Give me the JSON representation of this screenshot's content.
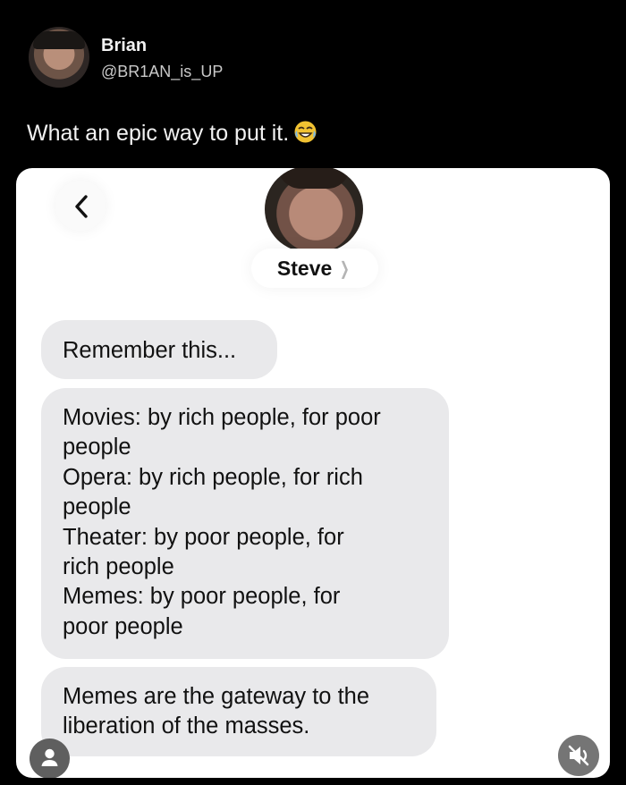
{
  "tweet": {
    "author_name": "Brian",
    "author_handle": "@BR1AN_is_UP",
    "text": "What an epic way to put it.",
    "emoji": "tears-of-joy-emoji"
  },
  "message_screen": {
    "contact_name": "Steve",
    "messages": [
      {
        "lines": [
          "Remember this..."
        ]
      },
      {
        "lines": [
          "Movies: by rich people, for poor",
          "people",
          "Opera: by rich people, for rich",
          "people",
          "Theater: by poor people, for",
          "rich people",
          "Memes: by poor people, for",
          "poor people"
        ]
      },
      {
        "lines": [
          "Memes are the gateway to the",
          "liberation of the masses."
        ]
      }
    ]
  },
  "icons": {
    "back": "chevron-left-icon",
    "contact_chevron": "chevron-right-icon",
    "person": "person-icon",
    "muted_audio": "speaker-muted-icon"
  },
  "colors": {
    "background": "#000000",
    "bubble": "#e9e9eb",
    "text_light": "#f2f2f2"
  }
}
